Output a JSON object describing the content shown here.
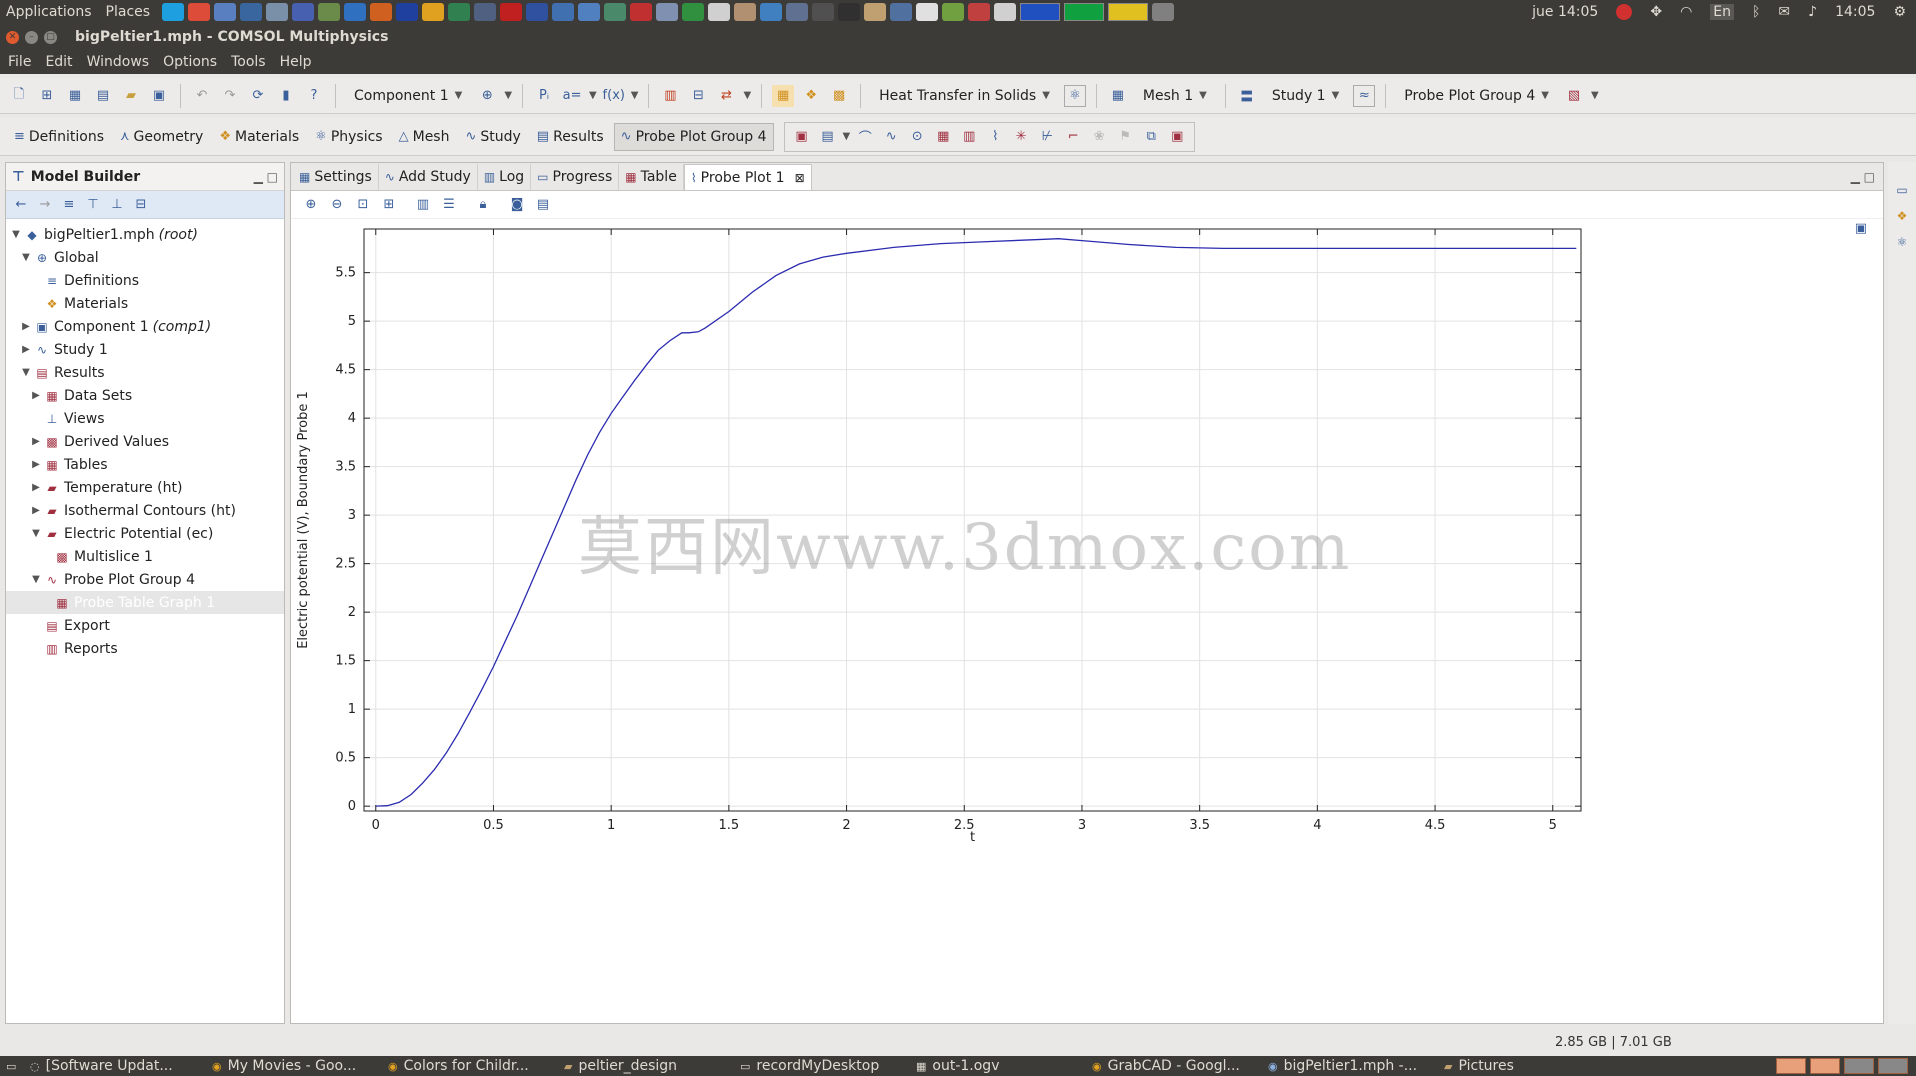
{
  "top_panel": {
    "applications": "Applications",
    "places": "Places",
    "date_time": "jue 14:05",
    "lang": "En",
    "clock": "14:05"
  },
  "window": {
    "title": "bigPeltier1.mph - COMSOL Multiphysics"
  },
  "menu": [
    "File",
    "Edit",
    "Windows",
    "Options",
    "Tools",
    "Help"
  ],
  "toolbar1": {
    "component": "Component 1",
    "physics": "Heat Transfer in Solids",
    "mesh": "Mesh 1",
    "study": "Study 1",
    "plot_group": "Probe Plot Group 4",
    "p_label": "Pᵢ",
    "a_label": "a=",
    "fx_label": "f(x)"
  },
  "ribbon": {
    "tabs": [
      "Definitions",
      "Geometry",
      "Materials",
      "Physics",
      "Mesh",
      "Study",
      "Results",
      "Probe Plot Group 4"
    ]
  },
  "model_builder": {
    "title": "Model Builder",
    "tree": [
      {
        "label": "bigPeltier1.mph",
        "suffix": "(root)",
        "level": 0,
        "tw": "▼",
        "icon": "root-icon"
      },
      {
        "label": "Global",
        "suffix": "",
        "level": 1,
        "tw": "▼",
        "icon": "global-icon"
      },
      {
        "label": "Definitions",
        "suffix": "",
        "level": 2,
        "tw": "",
        "icon": "definitions-icon"
      },
      {
        "label": "Materials",
        "suffix": "",
        "level": 2,
        "tw": "",
        "icon": "materials-icon"
      },
      {
        "label": "Component 1",
        "suffix": "(comp1)",
        "level": 1,
        "tw": "▶",
        "icon": "component-icon"
      },
      {
        "label": "Study 1",
        "suffix": "",
        "level": 1,
        "tw": "▶",
        "icon": "study-icon"
      },
      {
        "label": "Results",
        "suffix": "",
        "level": 1,
        "tw": "▼",
        "icon": "results-icon"
      },
      {
        "label": "Data Sets",
        "suffix": "",
        "level": 2,
        "tw": "▶",
        "icon": "datasets-icon"
      },
      {
        "label": "Views",
        "suffix": "",
        "level": 2,
        "tw": "",
        "icon": "views-icon"
      },
      {
        "label": "Derived Values",
        "suffix": "",
        "level": 2,
        "tw": "▶",
        "icon": "derived-values-icon"
      },
      {
        "label": "Tables",
        "suffix": "",
        "level": 2,
        "tw": "▶",
        "icon": "tables-icon"
      },
      {
        "label": "Temperature (ht)",
        "suffix": "",
        "level": 2,
        "tw": "▶",
        "icon": "plot-group-icon"
      },
      {
        "label": "Isothermal Contours (ht)",
        "suffix": "",
        "level": 2,
        "tw": "▶",
        "icon": "plot-group-icon"
      },
      {
        "label": "Electric Potential (ec)",
        "suffix": "",
        "level": 2,
        "tw": "▼",
        "icon": "plot-group-icon"
      },
      {
        "label": "Multislice 1",
        "suffix": "",
        "level": 3,
        "tw": "",
        "icon": "multislice-icon"
      },
      {
        "label": "Probe Plot Group 4",
        "suffix": "",
        "level": 2,
        "tw": "▼",
        "icon": "probe-plot-icon"
      },
      {
        "label": "Probe Table Graph 1",
        "suffix": "",
        "level": 3,
        "tw": "",
        "icon": "table-graph-icon",
        "selected": true
      },
      {
        "label": "Export",
        "suffix": "",
        "level": 2,
        "tw": "",
        "icon": "export-icon"
      },
      {
        "label": "Reports",
        "suffix": "",
        "level": 2,
        "tw": "",
        "icon": "reports-icon"
      }
    ]
  },
  "graphics": {
    "tabs": [
      "Settings",
      "Add Study",
      "Log",
      "Progress",
      "Table",
      "Probe Plot 1"
    ],
    "active_tab": "Probe Plot 1"
  },
  "watermark": "莫西网www.3dmox.com",
  "status": {
    "memory": "2.85 GB | 7.01 GB"
  },
  "taskbar": [
    "[Software Updat...",
    "My Movies - Goo...",
    "Colors for Childr...",
    "peltier_design",
    "recordMyDesktop",
    "out-1.ogv",
    "GrabCAD - Googl...",
    "bigPeltier1.mph -...",
    "Pictures"
  ],
  "colors": {
    "plot_line": "#2b2bb0",
    "accent": "#3a5f9a"
  },
  "chart_data": {
    "type": "line",
    "title": "",
    "xlabel": "t",
    "ylabel": "Electric potential (V), Boundary Probe 1",
    "xlim": [
      -0.05,
      5.12
    ],
    "ylim": [
      -0.05,
      5.95
    ],
    "xticks": [
      0,
      0.5,
      1,
      1.5,
      2,
      2.5,
      3,
      3.5,
      4,
      4.5,
      5
    ],
    "yticks": [
      0,
      0.5,
      1,
      1.5,
      2,
      2.5,
      3,
      3.5,
      4,
      4.5,
      5,
      5.5
    ],
    "grid": true,
    "series": [
      {
        "x": [
          0,
          0.05,
          0.1,
          0.15,
          0.2,
          0.25,
          0.3,
          0.35,
          0.4,
          0.45,
          0.5,
          0.55,
          0.6,
          0.65,
          0.7,
          0.75,
          0.8,
          0.85,
          0.9,
          0.95,
          1.0,
          1.05,
          1.1,
          1.15,
          1.2,
          1.25,
          1.3,
          1.33,
          1.37,
          1.4,
          1.5,
          1.6,
          1.7,
          1.8,
          1.9,
          2.0,
          2.2,
          2.4,
          2.6,
          2.8,
          2.9,
          3.0,
          3.2,
          3.4,
          3.6,
          3.8,
          4.0,
          4.5,
          5.0,
          5.1
        ],
        "y": [
          0,
          0.005,
          0.04,
          0.12,
          0.24,
          0.38,
          0.55,
          0.75,
          0.97,
          1.2,
          1.44,
          1.7,
          1.96,
          2.24,
          2.52,
          2.8,
          3.08,
          3.36,
          3.62,
          3.85,
          4.05,
          4.22,
          4.39,
          4.55,
          4.7,
          4.8,
          4.88,
          4.88,
          4.89,
          4.93,
          5.1,
          5.3,
          5.47,
          5.59,
          5.66,
          5.7,
          5.76,
          5.8,
          5.82,
          5.84,
          5.85,
          5.83,
          5.79,
          5.76,
          5.75,
          5.75,
          5.75,
          5.75,
          5.75,
          5.75
        ]
      }
    ]
  }
}
